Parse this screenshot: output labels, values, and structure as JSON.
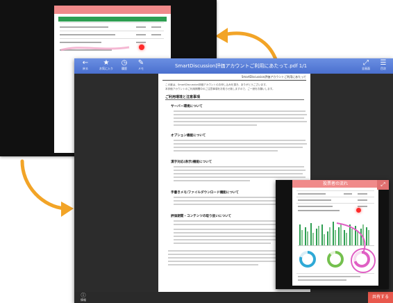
{
  "back_screenshot": {
    "header": "",
    "table_header": [
      "",
      "",
      ""
    ],
    "rows": [
      {
        "col1": "",
        "col2": ""
      },
      {
        "col1": "",
        "col2": ""
      },
      {
        "col1": "",
        "col2": ""
      },
      {
        "col1": "",
        "col2": ""
      }
    ]
  },
  "main_window": {
    "title": "SmartDiscussion評価アカウントご利用にあたって.pdf 1/1",
    "toolbar": [
      {
        "label": "戻る",
        "icon": "back-arrow-icon"
      },
      {
        "label": "お気に入り",
        "icon": "star-icon"
      },
      {
        "label": "履歴",
        "icon": "history-icon"
      },
      {
        "label": "メモ",
        "icon": "pencil-icon"
      }
    ],
    "toolbar_right": [
      {
        "label": "全画面",
        "icon": "fullscreen-icon"
      },
      {
        "label": "目次",
        "icon": "list-icon"
      }
    ],
    "document": {
      "doc_header": "SmartDiscussion評価アカウントご利用にあたって",
      "intro": "この度は、SmartDiscussion評価アカウントのお申し込みを頂き、ありがとうございます。",
      "intro2": "本評価アカウントのご利用期間中のご注意事項をお知らせ致しますので、ご一読をお願いします。",
      "main_heading": "ご利用環境と注意事項",
      "sections": [
        {
          "title": "サーバー環境について"
        },
        {
          "title": "オプション機能について"
        },
        {
          "title": "漢字対応(表示)機能について"
        },
        {
          "title": "手書きメモ/ファイルダウンロード機能について"
        },
        {
          "title": "評価期間・コンテンツの取り扱いについて"
        }
      ]
    },
    "bottom_button": "情報",
    "share_button": "共有する"
  },
  "overlay": {
    "header": "投票者の流れ"
  },
  "colors": {
    "toolbar_blue": "#5a7fd9",
    "header_red": "#f08a8a",
    "table_green": "#2e9e52",
    "arrow_orange": "#f2a427",
    "ring_cyan": "#2fa9d6",
    "ring_green": "#74c04e",
    "ring_pink": "#e05fc4"
  }
}
